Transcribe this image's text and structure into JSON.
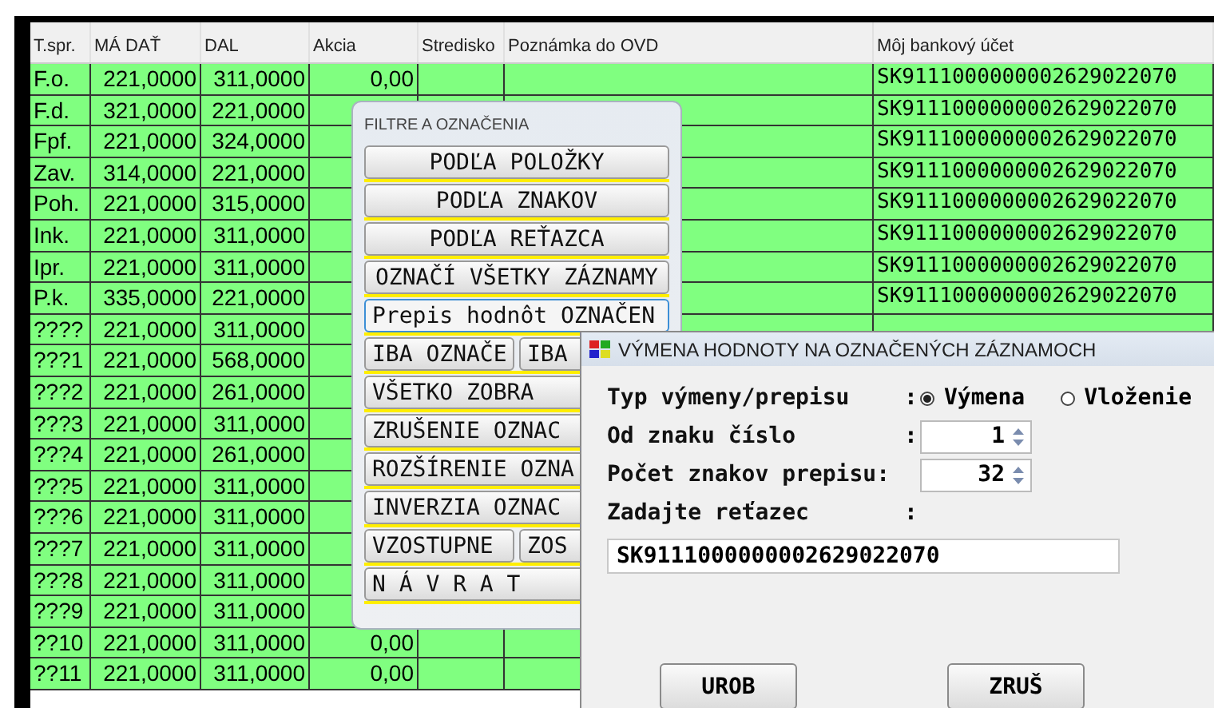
{
  "table": {
    "columns": [
      "T.spr.",
      "MÁ DAŤ",
      "DAL",
      "Akcia",
      "Stredisko",
      "Poznámka do OVD",
      "Môj bankový účet"
    ],
    "rows": [
      {
        "type": "F.o.",
        "ma_dat": "221,0000",
        "dal": "311,0000",
        "akcia": "0,00",
        "ucet": "SK9111000000002629022070"
      },
      {
        "type": "F.d.",
        "ma_dat": "321,0000",
        "dal": "221,0000",
        "ucet": "SK9111000000002629022070"
      },
      {
        "type": "Fpf.",
        "ma_dat": "221,0000",
        "dal": "324,0000",
        "ucet": "SK9111000000002629022070"
      },
      {
        "type": "Zav.",
        "ma_dat": "314,0000",
        "dal": "221,0000",
        "ucet": "SK9111000000002629022070"
      },
      {
        "type": "Poh.",
        "ma_dat": "221,0000",
        "dal": "315,0000",
        "ucet": "SK9111000000002629022070"
      },
      {
        "type": "Ink.",
        "ma_dat": "221,0000",
        "dal": "311,0000",
        "ucet": "SK9111000000002629022070"
      },
      {
        "type": "Ipr.",
        "ma_dat": "221,0000",
        "dal": "311,0000",
        "ucet": "SK9111000000002629022070"
      },
      {
        "type": "P.k.",
        "ma_dat": "335,0000",
        "dal": "221,0000",
        "ucet": "SK9111000000002629022070"
      },
      {
        "type": "????",
        "ma_dat": "221,0000",
        "dal": "311,0000"
      },
      {
        "type": "???1",
        "ma_dat": "221,0000",
        "dal": "568,0000"
      },
      {
        "type": "???2",
        "ma_dat": "221,0000",
        "dal": "261,0000"
      },
      {
        "type": "???3",
        "ma_dat": "221,0000",
        "dal": "311,0000"
      },
      {
        "type": "???4",
        "ma_dat": "221,0000",
        "dal": "261,0000"
      },
      {
        "type": "???5",
        "ma_dat": "221,0000",
        "dal": "311,0000"
      },
      {
        "type": "???6",
        "ma_dat": "221,0000",
        "dal": "311,0000"
      },
      {
        "type": "???7",
        "ma_dat": "221,0000",
        "dal": "311,0000"
      },
      {
        "type": "???8",
        "ma_dat": "221,0000",
        "dal": "311,0000"
      },
      {
        "type": "???9",
        "ma_dat": "221,0000",
        "dal": "311,0000"
      },
      {
        "type": "??10",
        "ma_dat": "221,0000",
        "dal": "311,0000",
        "akcia": "0,00"
      },
      {
        "type": "??11",
        "ma_dat": "221,0000",
        "dal": "311,0000",
        "akcia": "0,00"
      }
    ]
  },
  "filter_panel": {
    "title": "FILTRE A OZNAČENIA",
    "rows": [
      [
        {
          "label": "PODĽA POLOŽKY",
          "kind": "button"
        }
      ],
      [
        {
          "label": "PODĽA ZNAKOV",
          "kind": "button"
        }
      ],
      [
        {
          "label": "PODĽA REŤAZCA",
          "kind": "button"
        }
      ],
      [
        {
          "label": "OZNAČÍ VŠETKY ZÁZNAMY",
          "kind": "button"
        }
      ],
      [
        {
          "label": "Prepis hodnôt OZNAČEN",
          "kind": "focused"
        }
      ],
      [
        {
          "label": "IBA OZNAČE",
          "kind": "button"
        },
        {
          "label": "IBA",
          "kind": "button"
        }
      ],
      [
        {
          "label": "VŠETKO ZOBRA",
          "kind": "button"
        }
      ],
      [
        {
          "label": "ZRUŠENIE OZNAC",
          "kind": "button"
        }
      ],
      [
        {
          "label": "ROZŠÍRENIE OZNA",
          "kind": "button"
        }
      ],
      [
        {
          "label": "INVERZIA OZNAC",
          "kind": "button"
        }
      ],
      [
        {
          "label": "VZOSTUPNE",
          "kind": "button"
        },
        {
          "label": "ZOS",
          "kind": "button"
        }
      ],
      [
        {
          "label": "N Á V R A T",
          "kind": "button"
        }
      ]
    ]
  },
  "dialog": {
    "title": "VÝMENA HODNOTY NA OZNAČENÝCH ZÁZNAMOCH",
    "type_row": {
      "label": "Typ výmeny/prepisu",
      "colon": ":",
      "options": [
        {
          "label": "Výmena",
          "selected": true
        },
        {
          "label": "Vloženie",
          "selected": false
        }
      ]
    },
    "from_row": {
      "label": "Od znaku číslo",
      "colon": ":",
      "value": "1"
    },
    "count_row": {
      "label": "Počet znakov prepisu:",
      "value": "32"
    },
    "string_row": {
      "label": "Zadajte reťazec",
      "colon": ":",
      "value": "SK9111000000002629022070"
    },
    "buttons": [
      "UROB",
      "ZRUŠ"
    ]
  }
}
